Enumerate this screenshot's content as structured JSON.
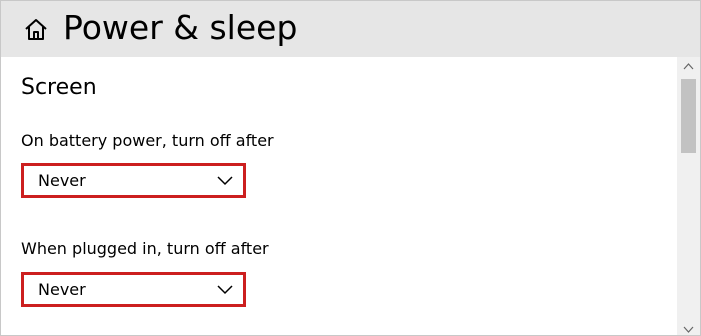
{
  "header": {
    "title": "Power & sleep",
    "icon": "home-icon"
  },
  "screen_section": {
    "title": "Screen",
    "battery": {
      "label": "On battery power, turn off after",
      "value": "Never"
    },
    "plugged": {
      "label": "When plugged in, turn off after",
      "value": "Never"
    }
  },
  "colors": {
    "header_bg": "#e6e6e6",
    "highlight_border": "#cc1f1f",
    "scrollbar_track": "#f0f0f0",
    "scrollbar_thumb": "#c2c2c2"
  }
}
